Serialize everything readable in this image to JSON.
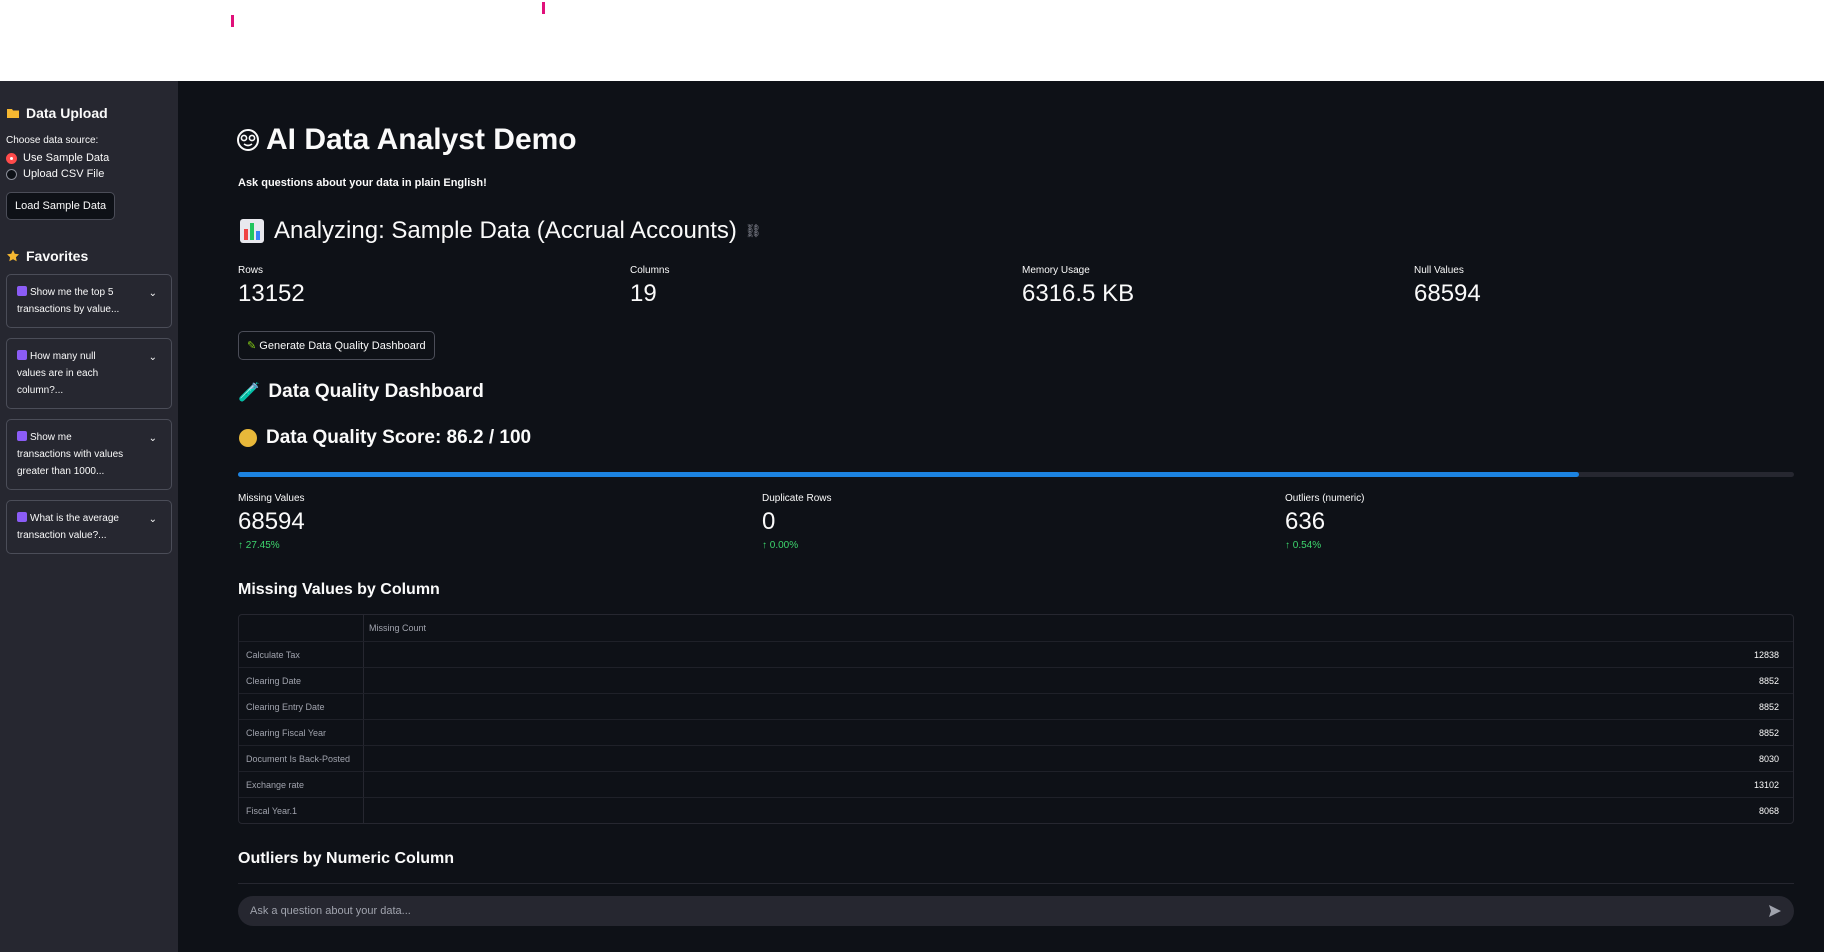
{
  "sidebar": {
    "upload_header": "Data Upload",
    "source_label": "Choose data source:",
    "source_options": [
      "Use Sample Data",
      "Upload CSV File"
    ],
    "selected_option": "Use Sample Data",
    "load_button": "Load Sample Data",
    "favorites_header": "Favorites",
    "favorites": [
      "Show me the top 5 transactions by value...",
      "How many null values are in each column?...",
      "Show me transactions with values greater than 1000...",
      "What is the average transaction value?..."
    ]
  },
  "main": {
    "title": "AI Data Analyst Demo",
    "subtitle": "Ask questions about your data in plain English!",
    "analyzing": "Analyzing: Sample Data (Accrual Accounts)",
    "metrics": [
      {
        "label": "Rows",
        "value": "13152"
      },
      {
        "label": "Columns",
        "value": "19"
      },
      {
        "label": "Memory Usage",
        "value": "6316.5 KB"
      },
      {
        "label": "Null Values",
        "value": "68594"
      }
    ],
    "generate_button": "Generate Data Quality Dashboard",
    "dq_header": "Data Quality Dashboard",
    "dq_score_text": "Data Quality Score: 86.2 / 100",
    "dq_score_fraction": 0.862,
    "quality_metrics": [
      {
        "label": "Missing Values",
        "value": "68594",
        "delta": "27.45%"
      },
      {
        "label": "Duplicate Rows",
        "value": "0",
        "delta": "0.00%"
      },
      {
        "label": "Outliers (numeric)",
        "value": "636",
        "delta": "0.54%"
      }
    ],
    "missing_header": "Missing Values by Column",
    "missing_table": {
      "column_header": "Missing Count",
      "rows": [
        {
          "name": "Calculate Tax",
          "count": "12838"
        },
        {
          "name": "Clearing Date",
          "count": "8852"
        },
        {
          "name": "Clearing Entry Date",
          "count": "8852"
        },
        {
          "name": "Clearing Fiscal Year",
          "count": "8852"
        },
        {
          "name": "Document Is Back-Posted",
          "count": "8030"
        },
        {
          "name": "Exchange rate",
          "count": "13102"
        },
        {
          "name": "Fiscal Year.1",
          "count": "8068"
        }
      ]
    },
    "outliers_header": "Outliers by Numeric Column",
    "chat_placeholder": "Ask a question about your data..."
  },
  "colors": {
    "accent": "#ff4b4b",
    "progress": "#1c83e1",
    "delta": "#3dd56d",
    "bg": "#0e1117",
    "sidebar": "#262730"
  }
}
